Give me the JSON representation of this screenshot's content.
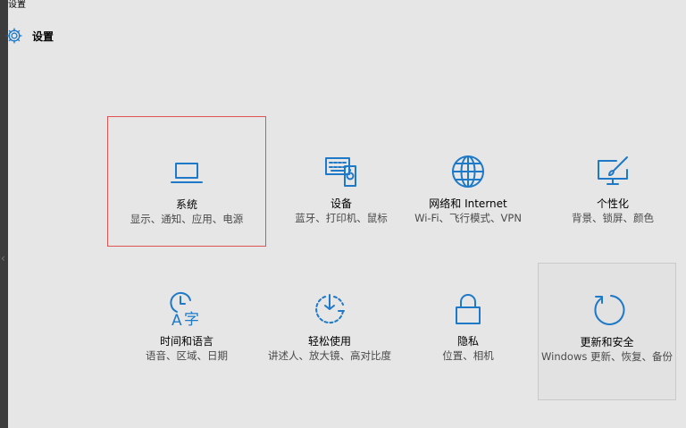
{
  "window": {
    "title": "设置"
  },
  "header": {
    "title": "设置",
    "icon": "gear-icon"
  },
  "colors": {
    "accent": "#1e79c8",
    "background": "#e6e6e6",
    "selection_border": "#e05353"
  },
  "tiles": [
    {
      "name": "系统",
      "desc": "显示、通知、应用、电源",
      "icon": "laptop-icon"
    },
    {
      "name": "设备",
      "desc": "蓝牙、打印机、鼠标",
      "icon": "devices-icon"
    },
    {
      "name": "网络和 Internet",
      "desc": "Wi-Fi、飞行模式、VPN",
      "icon": "globe-icon"
    },
    {
      "name": "个性化",
      "desc": "背景、锁屏、颜色",
      "icon": "personalization-icon"
    },
    {
      "name": "时间和语言",
      "desc": "语音、区域、日期",
      "icon": "time-language-icon"
    },
    {
      "name": "轻松使用",
      "desc": "讲述人、放大镜、高对比度",
      "icon": "ease-of-access-icon"
    },
    {
      "name": "隐私",
      "desc": "位置、相机",
      "icon": "lock-icon"
    },
    {
      "name": "更新和安全",
      "desc": "Windows 更新、恢复、备份",
      "icon": "refresh-icon"
    }
  ]
}
